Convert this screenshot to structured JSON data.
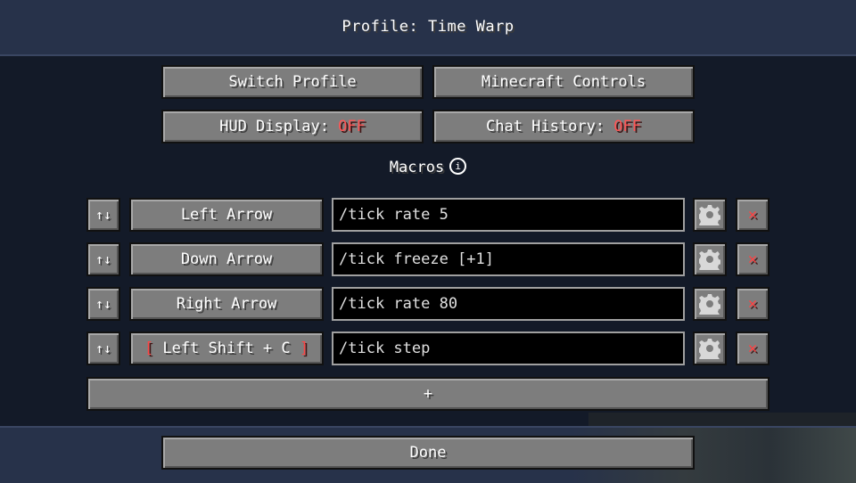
{
  "header": {
    "title": "Profile: Time Warp"
  },
  "buttons": {
    "switch_profile": "Switch Profile",
    "minecraft_controls": "Minecraft Controls",
    "hud_prefix": "HUD Display: ",
    "hud_state": "OFF",
    "chat_prefix": "Chat History: ",
    "chat_state": "OFF"
  },
  "macros": {
    "title": "Macros",
    "info_glyph": "i",
    "reorder_glyph": "↑↓",
    "delete_glyph": "✕",
    "rows": [
      {
        "key": "Left Arrow",
        "command": "/tick rate 5"
      },
      {
        "key": "Down Arrow",
        "command": "/tick freeze [+1]"
      },
      {
        "key": "Right Arrow",
        "command": "/tick rate 80"
      },
      {
        "key_open": "[ ",
        "key": "Left Shift + C",
        "key_close": " ]",
        "command": "/tick step"
      }
    ],
    "add_label": "+"
  },
  "footer": {
    "done_label": "Done"
  },
  "colors": {
    "off": "#ff5555",
    "button": "#7d7d7d",
    "field": "#000000",
    "background": "#131a28"
  },
  "icons": {
    "settings": "gear-icon",
    "delete": "close-icon",
    "reorder": "reorder-icon",
    "info": "info-icon"
  }
}
